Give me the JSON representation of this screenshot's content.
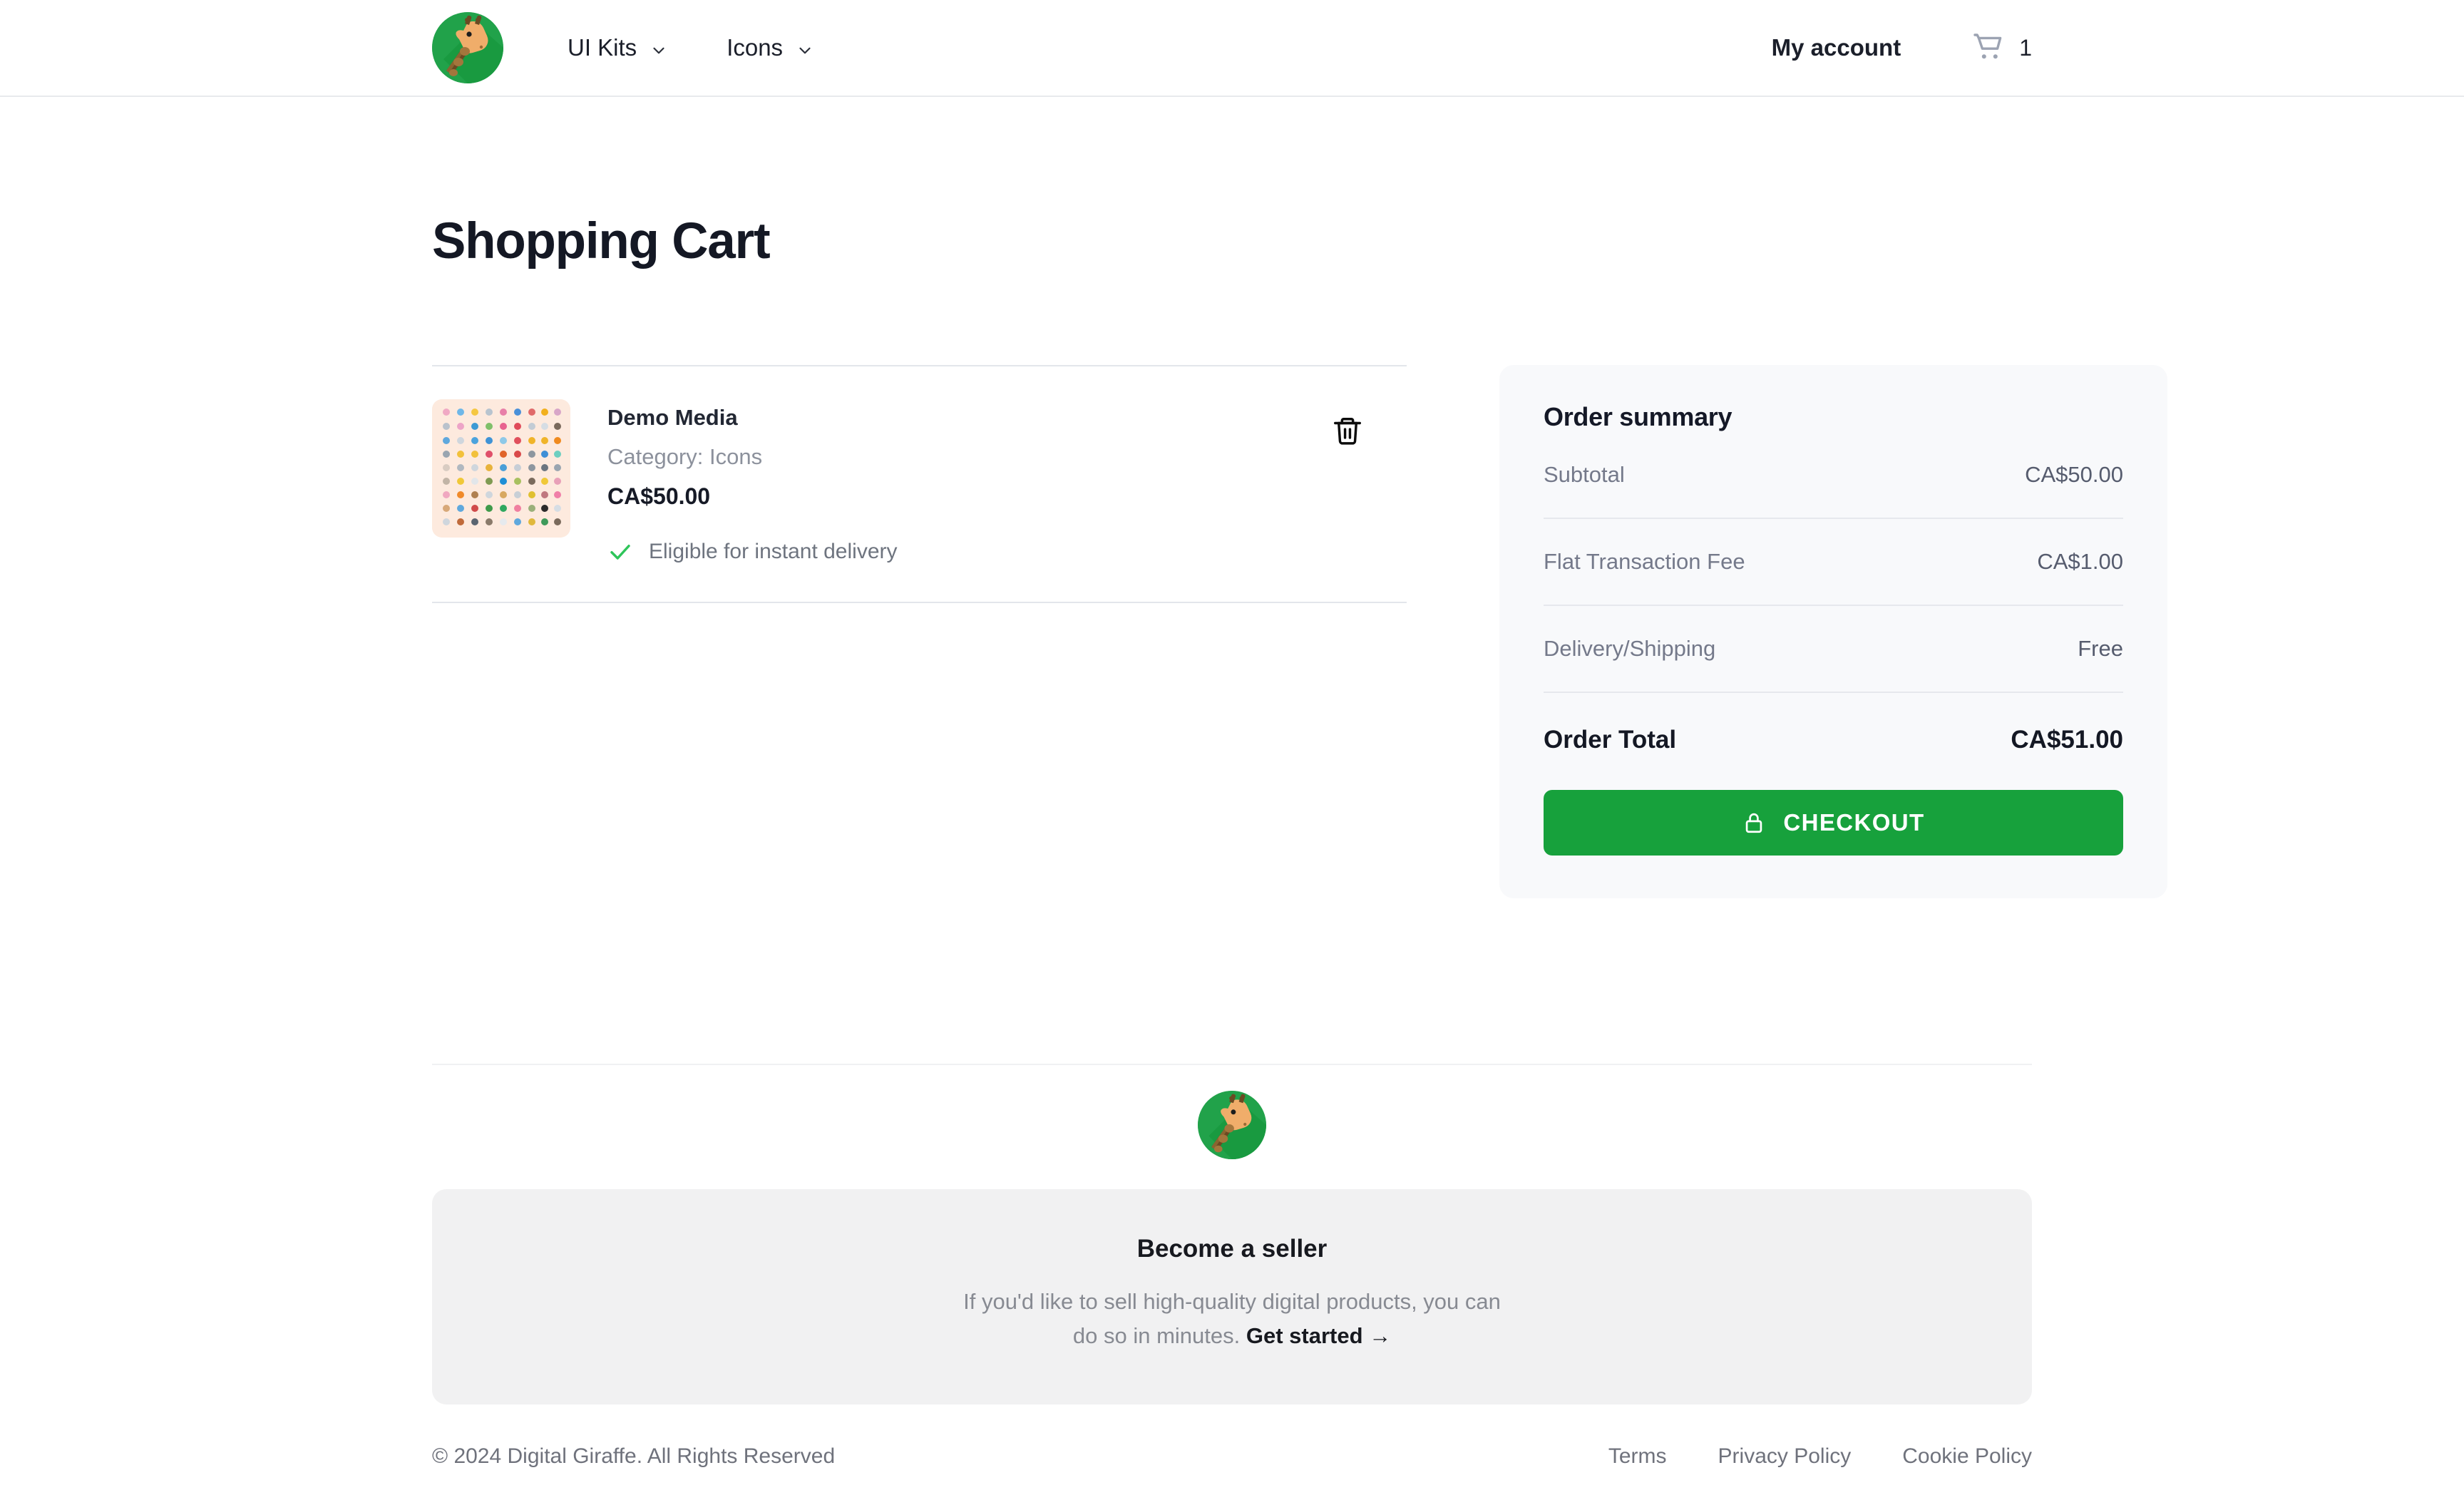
{
  "header": {
    "logo_icon": "giraffe-logo",
    "nav": [
      {
        "label": "UI Kits",
        "icon": "chevron-down-icon"
      },
      {
        "label": "Icons",
        "icon": "chevron-down-icon"
      }
    ],
    "account_label": "My account",
    "cart_icon": "shopping-cart-icon",
    "cart_count": "1"
  },
  "page": {
    "title": "Shopping Cart"
  },
  "cart": {
    "items": [
      {
        "thumbnail_icon": "icon-pack-thumbnail",
        "name": "Demo Media",
        "category": "Category: Icons",
        "price": "CA$50.00",
        "eligibility": "Eligible for instant delivery",
        "eligibility_icon": "check-icon",
        "remove_icon": "trash-icon"
      }
    ]
  },
  "summary": {
    "title": "Order summary",
    "rows": [
      {
        "label": "Subtotal",
        "value": "CA$50.00"
      },
      {
        "label": "Flat Transaction Fee",
        "value": "CA$1.00"
      },
      {
        "label": "Delivery/Shipping",
        "value": "Free"
      }
    ],
    "total": {
      "label": "Order Total",
      "value": "CA$51.00"
    },
    "checkout_label": "CHECKOUT",
    "checkout_icon": "lock-icon"
  },
  "footer": {
    "logo_icon": "giraffe-logo",
    "seller": {
      "title": "Become a seller",
      "description": "If you'd like to sell high-quality digital products, you can do so in minutes. ",
      "link_label": "Get started →"
    },
    "copyright": "© 2024 Digital Giraffe. All Rights Reserved",
    "links": [
      {
        "label": "Terms"
      },
      {
        "label": "Privacy Policy"
      },
      {
        "label": "Cookie Policy"
      }
    ]
  },
  "colors": {
    "brand_green": "#21a24a",
    "checkout_green": "#17a13c",
    "check_green": "#2ec55a",
    "title_dark": "#141824",
    "muted_gray": "#8c919c",
    "card_bg": "#f8f9fb",
    "panel_bg": "#f1f1f2",
    "divider": "#e3e6eb",
    "thumb_bg": "#fdeade"
  }
}
